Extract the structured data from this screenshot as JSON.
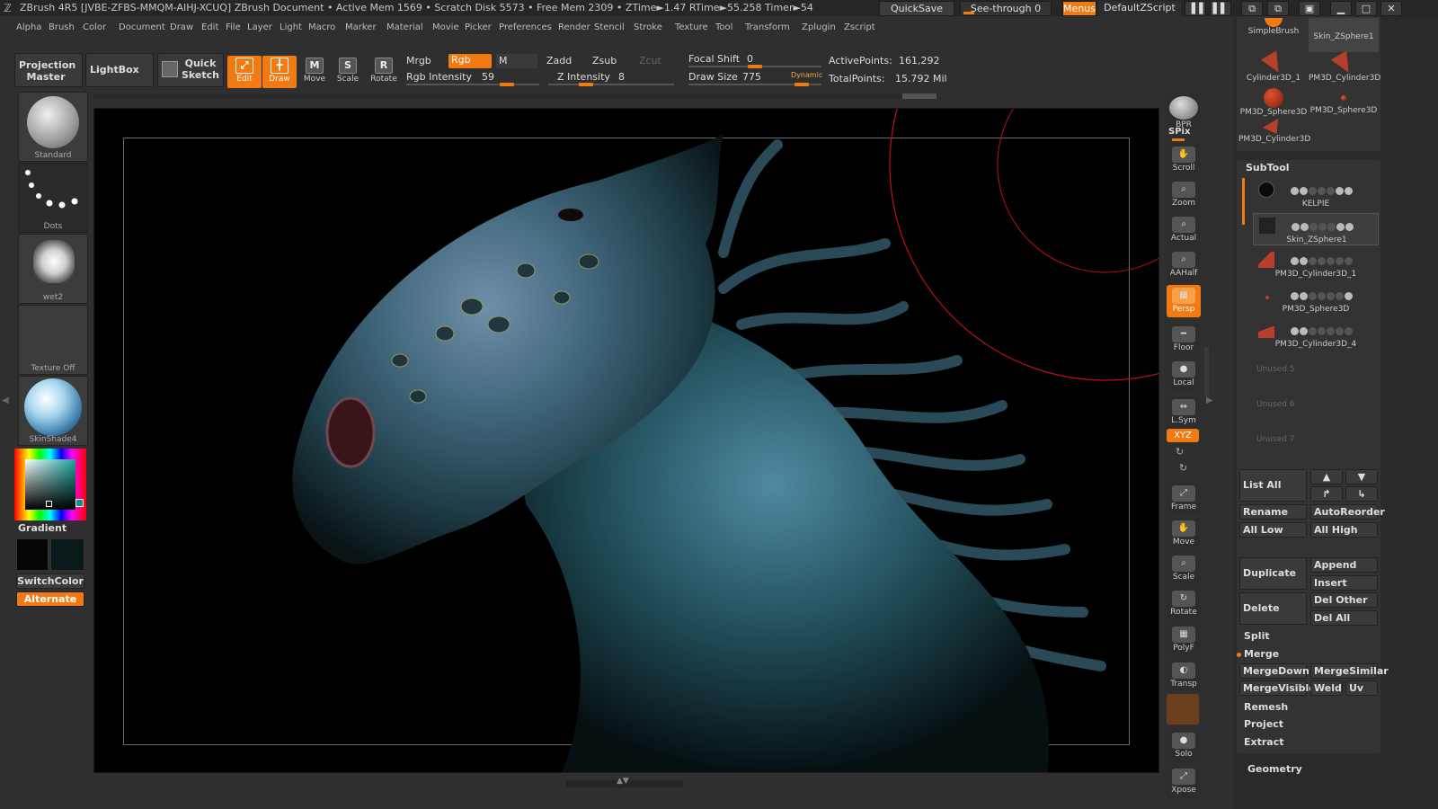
{
  "titlebar": {
    "info": "ZBrush 4R5 [JVBE-ZFBS-MMQM-AIHJ-XCUQ]   ZBrush Document      • Active Mem 1569 • Scratch Disk 5573 • Free Mem 2309 • ZTime►1.47 RTime►55.258 Timer►54",
    "quicksave": "QuickSave",
    "seethrough": "See-through  0",
    "menus": "Menus",
    "defaultzscript": "DefaultZScript"
  },
  "menubar": [
    "Alpha",
    "Brush",
    "Color",
    "Document",
    "Draw",
    "Edit",
    "File",
    "Layer",
    "Light",
    "Macro",
    "Marker",
    "Material",
    "Movie",
    "Picker",
    "Preferences",
    "Render",
    "Stencil",
    "Stroke",
    "Texture",
    "Tool",
    "Transform",
    "Zplugin",
    "Zscript"
  ],
  "toolbar": {
    "projection_master": "Projection Master",
    "lightbox": "LightBox",
    "quick_sketch": "Quick Sketch",
    "edit": "Edit",
    "draw": "Draw",
    "move": "Move",
    "scale": "Scale",
    "rotate": "Rotate",
    "mrgb": "Mrgb",
    "rgb": "Rgb",
    "m": "M",
    "zadd": "Zadd",
    "zsub": "Zsub",
    "zcut": "Zcut",
    "rgb_intensity_label": "Rgb Intensity",
    "rgb_intensity": 59,
    "z_intensity_label": "Z Intensity",
    "z_intensity": 8,
    "focal_shift_label": "Focal Shift",
    "focal_shift": 0,
    "draw_size_label": "Draw Size",
    "draw_size": 775,
    "dynamic": "Dynamic",
    "active_points_label": "ActivePoints:",
    "active_points": "161,292",
    "total_points_label": "TotalPoints:",
    "total_points": "15.792 Mil"
  },
  "leftshelf": {
    "brush": "Standard",
    "stroke": "Dots",
    "alpha": "wet2",
    "texture": "Texture Off",
    "material": "SkinShade4",
    "gradient": "Gradient",
    "switchcolor": "SwitchColor",
    "alternate": "Alternate"
  },
  "rightshelf": {
    "bpr": "BPR",
    "spix": "SPix",
    "scroll": "Scroll",
    "zoom": "Zoom",
    "actual": "Actual",
    "aahalf": "AAHalf",
    "persp": "Persp",
    "floor": "Floor",
    "local": "Local",
    "lsym": "L.Sym",
    "xyz": "XYZ",
    "frame": "Frame",
    "move": "Move",
    "scale": "Scale",
    "rotate": "Rotate",
    "polyf": "PolyF",
    "transp": "Transp",
    "solo": "Solo",
    "xpose": "Xpose"
  },
  "tool_palette": [
    "SimpleBrush",
    "Skin_ZSphere1",
    "Cylinder3D_1",
    "PM3D_Cylinder3D",
    "PM3D_Sphere3D",
    "PM3D_Sphere3D",
    "PM3D_Cylinder3D"
  ],
  "subtool": {
    "title": "SubTool",
    "items": [
      "KELPIE",
      "Skin_ZSphere1",
      "PM3D_Cylinder3D_1",
      "PM3D_Sphere3D",
      "PM3D_Cylinder3D_4"
    ],
    "unused": [
      "Unused 5",
      "Unused 6",
      "Unused 7"
    ],
    "list_all": "List  All",
    "rename": "Rename",
    "autoreorder": "AutoReorder",
    "all_low": "All Low",
    "all_high": "All High",
    "duplicate": "Duplicate",
    "append": "Append",
    "insert": "Insert",
    "delete": "Delete",
    "del_other": "Del Other",
    "del_all": "Del All",
    "split": "Split",
    "merge": "Merge",
    "mergedown": "MergeDown",
    "mergesimilar": "MergeSimilar",
    "mergevisible": "MergeVisible",
    "weld": "Weld",
    "uv": "Uv",
    "remesh": "Remesh",
    "project": "Project",
    "extract": "Extract",
    "geometry": "Geometry"
  },
  "colors": {
    "accent": "#f27a12",
    "panel": "#2f2f2f",
    "canvas": "#000000",
    "brush_circle": "#c01010"
  }
}
